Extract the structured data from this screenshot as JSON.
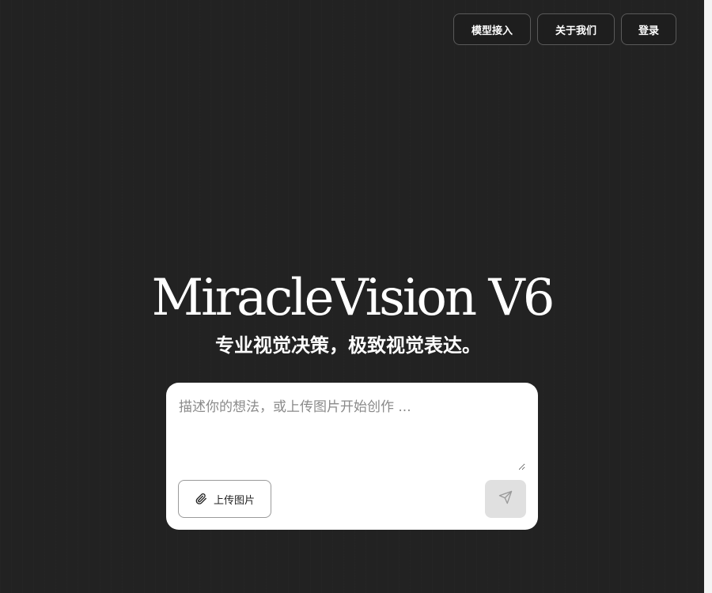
{
  "header": {
    "nav": {
      "models_label": "模型接入",
      "about_label": "关于我们",
      "login_label": "登录"
    }
  },
  "hero": {
    "title": "MiracleVision V6",
    "subtitle": "专业视觉决策，极致视觉表达。"
  },
  "composer": {
    "prompt_placeholder": "描述你的想法，或上传图片开始创作 ...",
    "prompt_value": "",
    "upload_label": "上传图片",
    "upload_icon": "paperclip-icon",
    "send_icon": "send-icon"
  },
  "colors": {
    "background": "#222222",
    "text": "#ffffff",
    "card": "#ffffff",
    "send_disabled": "#e0e0e0"
  }
}
